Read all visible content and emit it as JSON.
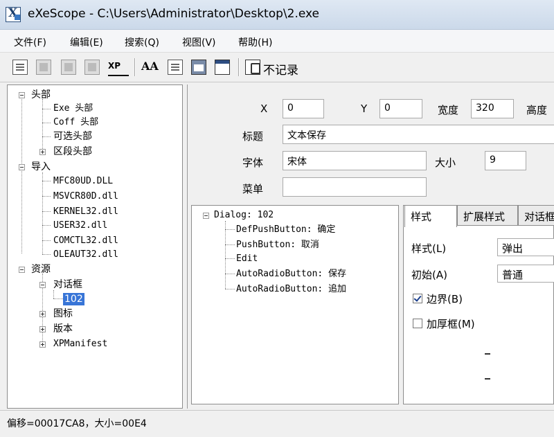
{
  "window": {
    "title": "eXeScope - C:\\Users\\Administrator\\Desktop\\2.exe"
  },
  "menu": [
    "文件(F)",
    "编辑(E)",
    "搜索(Q)",
    "视图(V)",
    "帮助(H)"
  ],
  "toolbar": {
    "xp_label": "XP",
    "font_label": "AA",
    "no_record_label": "不记录"
  },
  "tree": {
    "header": "头部",
    "header_children": [
      "Exe 头部",
      "Coff 头部",
      "可选头部",
      "区段头部"
    ],
    "import": "导入",
    "import_children": [
      "MFC80UD.DLL",
      "MSVCR80D.dll",
      "KERNEL32.dll",
      "USER32.dll",
      "COMCTL32.dll",
      "OLEAUT32.dll"
    ],
    "resources": "资源",
    "dialog": "对话框",
    "dialog_item": "102",
    "icon": "图标",
    "version": "版本",
    "manifest": "XPManifest"
  },
  "form": {
    "x_label": "X",
    "x_value": "0",
    "y_label": "Y",
    "y_value": "0",
    "width_label": "宽度",
    "width_value": "320",
    "height_label": "高度",
    "caption_label": "标题",
    "caption_value": "文本保存",
    "font_label": "字体",
    "font_value": "宋体",
    "size_label": "大小",
    "size_value": "9",
    "menu_label": "菜单",
    "menu_value": ""
  },
  "dialog_tree": {
    "root": "Dialog: 102",
    "items": [
      "DefPushButton: 确定",
      "PushButton: 取消",
      "Edit",
      "AutoRadioButton: 保存",
      "AutoRadioButton: 追加"
    ]
  },
  "tabs": [
    "样式",
    "扩展样式",
    "对话框"
  ],
  "style_panel": {
    "style_label": "样式(L)",
    "style_value": "弹出",
    "init_label": "初始(A)",
    "init_value": "普通",
    "border_label": "边界(B)",
    "border_checked": true,
    "thick_label": "加厚框(M)",
    "thick_checked": false
  },
  "status": "偏移=00017CA8，大小=00E4"
}
